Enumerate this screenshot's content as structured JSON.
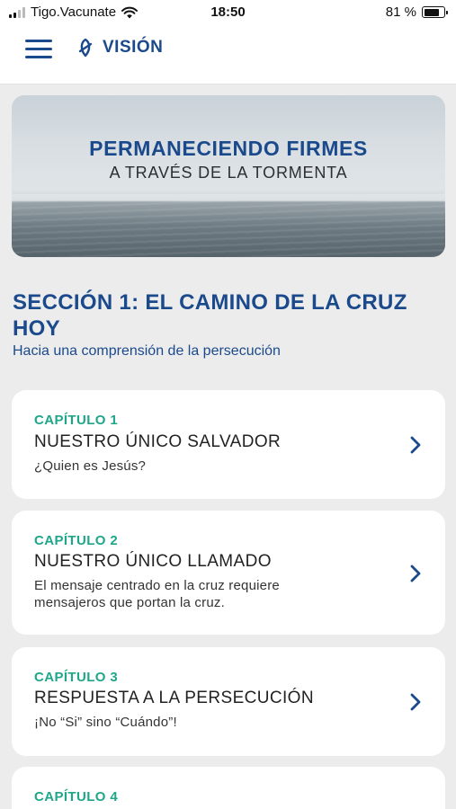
{
  "status_bar": {
    "carrier": "Tigo.Vacunate",
    "time": "18:50",
    "battery": "81 %",
    "battery_level": 0.81,
    "signal_bars": 2,
    "icons": [
      "signal-icon",
      "wifi-icon",
      "battery-icon"
    ]
  },
  "header": {
    "menu_icon": "hamburger-menu-icon",
    "logo_icon": "vision-logo-icon",
    "title": "VISIÓN"
  },
  "hero": {
    "title": "PERMANECIENDO FIRMES",
    "subtitle": "A TRAVÉS DE LA TORMENTA"
  },
  "section": {
    "title": "SECCIÓN 1: EL CAMINO DE LA CRUZ HOY",
    "subtitle": "Hacia una comprensión de la persecución"
  },
  "chapters": [
    {
      "kicker": "CAPÍTULO 1",
      "title": "NUESTRO ÚNICO SALVADOR",
      "description_lines": [
        "¿Quien es Jesús?"
      ]
    },
    {
      "kicker": "CAPÍTULO 2",
      "title": "NUESTRO ÚNICO LLAMADO",
      "description_lines": [
        "El mensaje centrado en la cruz requiere",
        "mensajeros que portan la cruz."
      ]
    },
    {
      "kicker": "CAPÍTULO 3",
      "title": "RESPUESTA A LA PERSECUCIÓN",
      "description_lines": [
        "¡No “Si” sino “Cuándo”!"
      ]
    },
    {
      "kicker": "CAPÍTULO 4",
      "title": "",
      "description_lines": []
    }
  ],
  "colors": {
    "brand_blue": "#1b4a8c",
    "accent_green": "#1fa68a",
    "background": "#ececec",
    "card": "#ffffff"
  }
}
